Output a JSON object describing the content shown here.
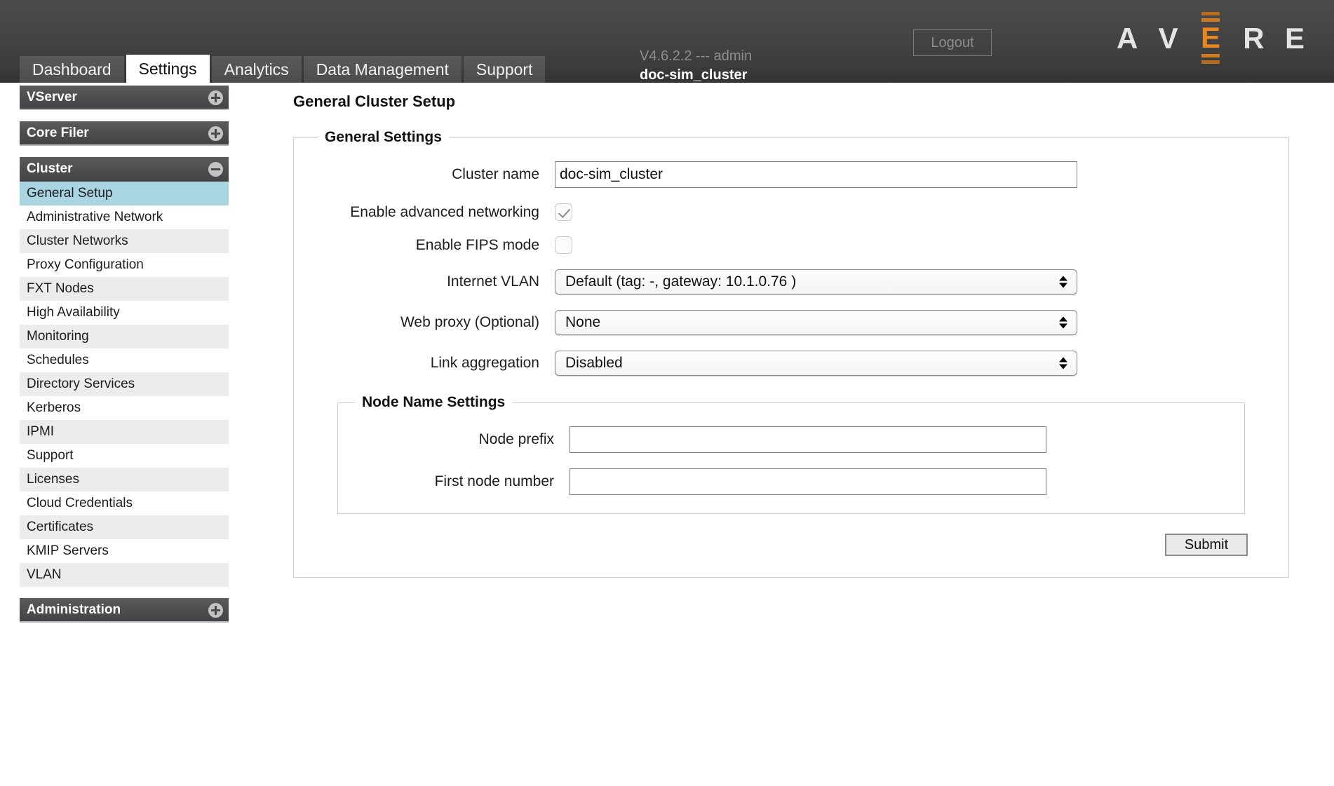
{
  "header": {
    "logout_label": "Logout",
    "version_line": "V4.6.2.2 --- admin",
    "cluster_line": "doc-sim_cluster",
    "logo": {
      "l1": "A",
      "l2": "V",
      "l3": "E",
      "l4": "R",
      "l5": "E",
      "accent_color": "#e8861f"
    }
  },
  "tabs": [
    {
      "label": "Dashboard",
      "active": false
    },
    {
      "label": "Settings",
      "active": true
    },
    {
      "label": "Analytics",
      "active": false
    },
    {
      "label": "Data Management",
      "active": false
    },
    {
      "label": "Support",
      "active": false
    }
  ],
  "sidebar": {
    "groups": [
      {
        "label": "VServer",
        "icon": "plus-circle-icon",
        "expanded": false
      },
      {
        "label": "Core Filer",
        "icon": "plus-circle-icon",
        "expanded": false
      },
      {
        "label": "Cluster",
        "icon": "minus-circle-icon",
        "expanded": true
      },
      {
        "label": "Administration",
        "icon": "plus-circle-icon",
        "expanded": false
      }
    ],
    "cluster_items": [
      {
        "label": "General Setup",
        "selected": true
      },
      {
        "label": "Administrative Network",
        "selected": false
      },
      {
        "label": "Cluster Networks",
        "selected": false
      },
      {
        "label": "Proxy Configuration",
        "selected": false
      },
      {
        "label": "FXT Nodes",
        "selected": false
      },
      {
        "label": "High Availability",
        "selected": false
      },
      {
        "label": "Monitoring",
        "selected": false
      },
      {
        "label": "Schedules",
        "selected": false
      },
      {
        "label": "Directory Services",
        "selected": false
      },
      {
        "label": "Kerberos",
        "selected": false
      },
      {
        "label": "IPMI",
        "selected": false
      },
      {
        "label": "Support",
        "selected": false
      },
      {
        "label": "Licenses",
        "selected": false
      },
      {
        "label": "Cloud Credentials",
        "selected": false
      },
      {
        "label": "Certificates",
        "selected": false
      },
      {
        "label": "KMIP Servers",
        "selected": false
      },
      {
        "label": "VLAN",
        "selected": false
      }
    ],
    "selected_color": "#a9d5e3"
  },
  "main": {
    "page_title": "General Cluster Setup",
    "general_settings": {
      "legend": "General Settings",
      "cluster_name_label": "Cluster name",
      "cluster_name_value": "doc-sim_cluster",
      "advanced_networking_label": "Enable advanced networking",
      "advanced_networking_checked": true,
      "fips_label": "Enable FIPS mode",
      "fips_checked": false,
      "internet_vlan_label": "Internet VLAN",
      "internet_vlan_value": "Default (tag: -, gateway: 10.1.0.76 )",
      "web_proxy_label": "Web proxy (Optional)",
      "web_proxy_value": "None",
      "link_aggregation_label": "Link aggregation",
      "link_aggregation_value": "Disabled"
    },
    "node_name_settings": {
      "legend": "Node Name Settings",
      "node_prefix_label": "Node prefix",
      "node_prefix_value": "",
      "first_node_number_label": "First node number",
      "first_node_number_value": ""
    },
    "submit_label": "Submit"
  }
}
